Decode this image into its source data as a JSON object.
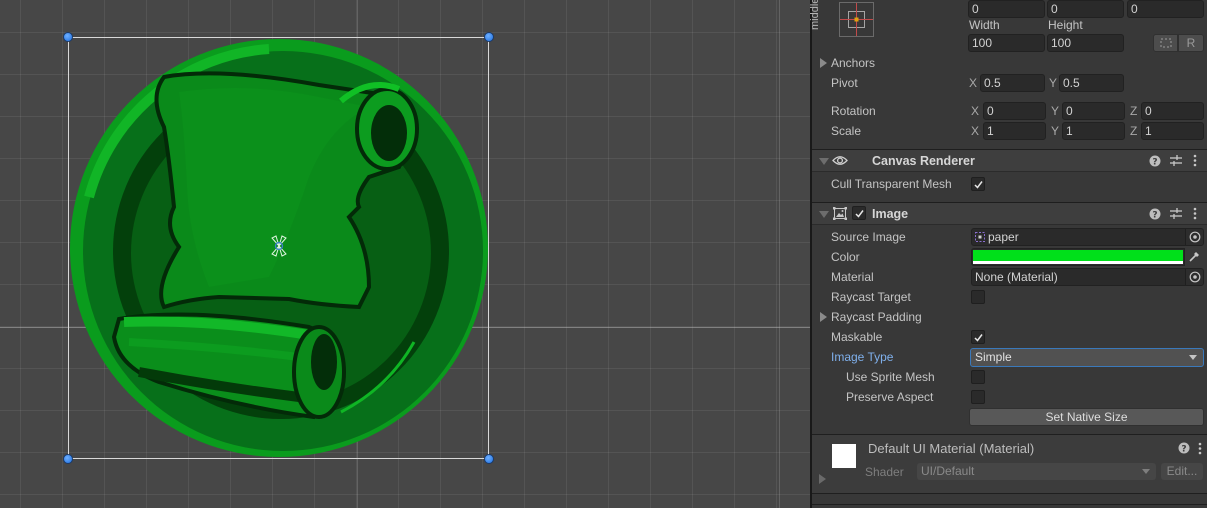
{
  "scene": {
    "sprite_name": "paper",
    "tint_color": "#00e01a",
    "selection_color": "#d8d8d8",
    "handle_color": "#2f7ff0"
  },
  "inspector": {
    "rect_transform": {
      "anchor_preset_label": "middle",
      "position": [
        "0",
        "0",
        "0"
      ],
      "width_label": "Width",
      "height_label": "Height",
      "width": "100",
      "height": "100",
      "blueprint_button_icon": "dashed-rect-icon",
      "raw_button_label": "R",
      "anchors_label": "Anchors",
      "pivot_label": "Pivot",
      "pivot": {
        "x_label": "X",
        "x": "0.5",
        "y_label": "Y",
        "y": "0.5"
      },
      "rotation_label": "Rotation",
      "rotation": {
        "x_label": "X",
        "x": "0",
        "y_label": "Y",
        "y": "0",
        "z_label": "Z",
        "z": "0"
      },
      "scale_label": "Scale",
      "scale": {
        "x_label": "X",
        "x": "1",
        "y_label": "Y",
        "y": "1",
        "z_label": "Z",
        "z": "1"
      }
    },
    "canvas_renderer": {
      "title": "Canvas Renderer",
      "icon": "eye-icon",
      "cull_label": "Cull Transparent Mesh",
      "cull_checked": true
    },
    "image": {
      "title": "Image",
      "enabled": true,
      "icon": "image-icon",
      "source_image_label": "Source Image",
      "source_image_value": "paper",
      "color_label": "Color",
      "color_value": "#00e01a",
      "material_label": "Material",
      "material_value": "None (Material)",
      "raycast_target_label": "Raycast Target",
      "raycast_target_checked": false,
      "raycast_padding_label": "Raycast Padding",
      "maskable_label": "Maskable",
      "maskable_checked": true,
      "image_type_label": "Image Type",
      "image_type_value": "Simple",
      "use_sprite_mesh_label": "Use Sprite Mesh",
      "use_sprite_mesh_checked": false,
      "preserve_aspect_label": "Preserve Aspect",
      "preserve_aspect_checked": false,
      "set_native_size_label": "Set Native Size"
    },
    "material": {
      "title": "Default UI Material (Material)",
      "shader_label": "Shader",
      "shader_value": "UI/Default",
      "edit_label": "Edit..."
    }
  }
}
